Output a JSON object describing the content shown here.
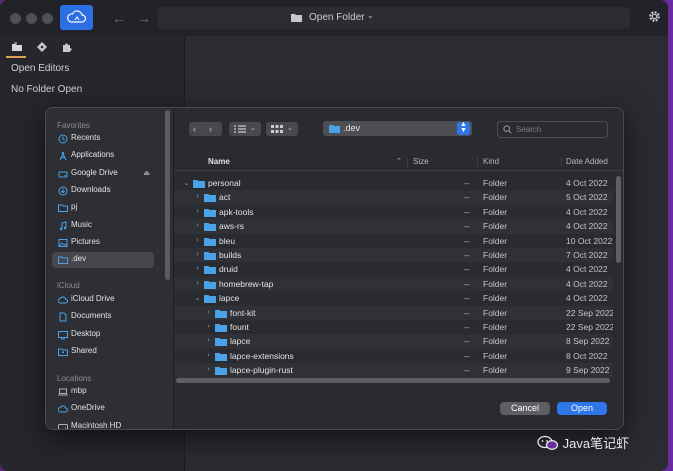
{
  "titlebar": {
    "title": "Open Folder"
  },
  "colors": {
    "accent": "#2f76e8",
    "folder": "#4aa3e8",
    "tab_indicator": "#d8a34a"
  },
  "sidebar": {
    "open_editors": "Open Editors",
    "no_folder": "No Folder Open"
  },
  "dialog": {
    "sections": [
      {
        "title": "Favorites",
        "items": [
          {
            "label": "Recents",
            "icon": "clock-icon"
          },
          {
            "label": "Applications",
            "icon": "applications-icon"
          },
          {
            "label": "Google Drive",
            "icon": "drive-icon"
          },
          {
            "label": "Downloads",
            "icon": "download-icon"
          },
          {
            "label": "pj",
            "icon": "folder-icon"
          },
          {
            "label": "Music",
            "icon": "music-icon"
          },
          {
            "label": "Pictures",
            "icon": "pictures-icon"
          },
          {
            "label": ".dev",
            "icon": "folder-icon"
          }
        ]
      },
      {
        "title": "iCloud",
        "items": [
          {
            "label": "iCloud Drive",
            "icon": "cloud-icon"
          },
          {
            "label": "Documents",
            "icon": "document-icon"
          },
          {
            "label": "Desktop",
            "icon": "desktop-icon"
          },
          {
            "label": "Shared",
            "icon": "shared-icon"
          }
        ]
      },
      {
        "title": "Locations",
        "items": [
          {
            "label": "mbp",
            "icon": "laptop-icon"
          },
          {
            "label": "OneDrive",
            "icon": "cloud-icon"
          },
          {
            "label": "Macintosh HD",
            "icon": "disk-icon"
          }
        ]
      }
    ],
    "location": ".dev",
    "search": {
      "placeholder": "Search"
    },
    "columns": {
      "name": "Name",
      "size": "Size",
      "kind": "Kind",
      "date": "Date Added"
    },
    "files": [
      {
        "name": "personal",
        "depth": 0,
        "expanded": true,
        "size": "--",
        "kind": "Folder",
        "date": "4 Oct 2022"
      },
      {
        "name": "act",
        "depth": 1,
        "expanded": false,
        "size": "--",
        "kind": "Folder",
        "date": "5 Oct 2022"
      },
      {
        "name": "apk-tools",
        "depth": 1,
        "expanded": false,
        "size": "--",
        "kind": "Folder",
        "date": "4 Oct 2022"
      },
      {
        "name": "aws-rs",
        "depth": 1,
        "expanded": false,
        "size": "--",
        "kind": "Folder",
        "date": "4 Oct 2022"
      },
      {
        "name": "bleu",
        "depth": 1,
        "expanded": false,
        "size": "--",
        "kind": "Folder",
        "date": "10 Oct 2022"
      },
      {
        "name": "builds",
        "depth": 1,
        "expanded": false,
        "size": "--",
        "kind": "Folder",
        "date": "7 Oct 2022"
      },
      {
        "name": "druid",
        "depth": 1,
        "expanded": false,
        "size": "--",
        "kind": "Folder",
        "date": "4 Oct 2022"
      },
      {
        "name": "homebrew-tap",
        "depth": 1,
        "expanded": false,
        "size": "--",
        "kind": "Folder",
        "date": "4 Oct 2022"
      },
      {
        "name": "lapce",
        "depth": 1,
        "expanded": true,
        "size": "--",
        "kind": "Folder",
        "date": "4 Oct 2022"
      },
      {
        "name": "font-kit",
        "depth": 2,
        "expanded": false,
        "size": "--",
        "kind": "Folder",
        "date": "22 Sep 2022"
      },
      {
        "name": "fount",
        "depth": 2,
        "expanded": false,
        "size": "--",
        "kind": "Folder",
        "date": "22 Sep 2022"
      },
      {
        "name": "lapce",
        "depth": 2,
        "expanded": false,
        "size": "--",
        "kind": "Folder",
        "date": "8 Sep 2022"
      },
      {
        "name": "lapce-extensions",
        "depth": 2,
        "expanded": false,
        "size": "--",
        "kind": "Folder",
        "date": "8 Oct 2022"
      },
      {
        "name": "lapce-plugin-rust",
        "depth": 2,
        "expanded": false,
        "size": "--",
        "kind": "Folder",
        "date": "9 Sep 2022"
      }
    ],
    "buttons": {
      "cancel": "Cancel",
      "open": "Open"
    }
  },
  "watermark": "Java笔记虾"
}
